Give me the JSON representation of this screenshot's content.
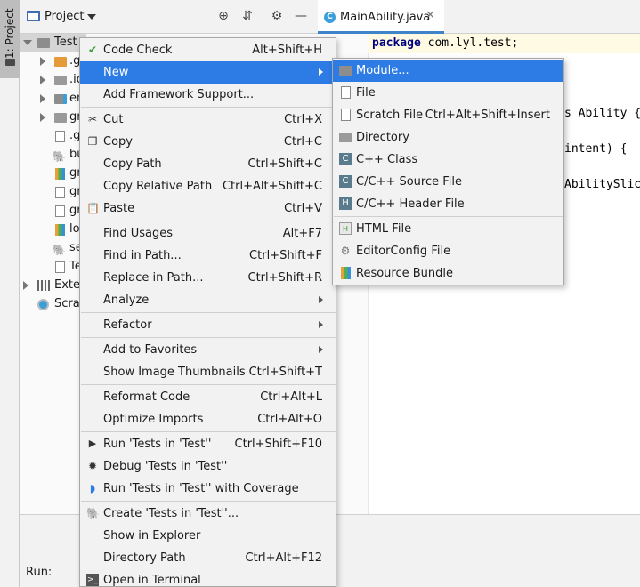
{
  "left_stripe": {
    "project_tab": "1: Project"
  },
  "project_panel": {
    "title": "Project",
    "tree": [
      {
        "label": "Test",
        "icon": "module-folder-icon"
      },
      {
        "label": ".g",
        "icon": "folder-orange-icon"
      },
      {
        "label": ".id",
        "icon": "folder-icon"
      },
      {
        "label": "en",
        "icon": "module-folder-icon"
      },
      {
        "label": "gr",
        "icon": "folder-icon"
      },
      {
        "label": ".g",
        "icon": "file-icon"
      },
      {
        "label": "bu",
        "icon": "gradle-icon"
      },
      {
        "label": "gr",
        "icon": "properties-file-icon"
      },
      {
        "label": "gr",
        "icon": "file-icon"
      },
      {
        "label": "gr",
        "icon": "file-icon"
      },
      {
        "label": "lo",
        "icon": "properties-file-icon"
      },
      {
        "label": "se",
        "icon": "gradle-icon"
      },
      {
        "label": "Te",
        "icon": "file-icon"
      },
      {
        "label": "Exter",
        "icon": "library-icon"
      },
      {
        "label": "Scrat",
        "icon": "scratches-icon"
      }
    ]
  },
  "editor": {
    "tab_label": "MainAbility.java",
    "code": {
      "line1_keyword": "package",
      "line1_rest": " com.lyl.test;",
      "frag1": "s Ability {",
      "frag2": "intent) {",
      "frag3": "AbilitySlice"
    }
  },
  "run_bar": {
    "label": "Run:"
  },
  "context_menu": {
    "items": [
      {
        "label": "Code Check",
        "shortcut": "Alt+Shift+H"
      },
      {
        "label": "New",
        "shortcut": ""
      },
      {
        "label": "Add Framework Support...",
        "shortcut": ""
      },
      {
        "label": "Cut",
        "shortcut": "Ctrl+X"
      },
      {
        "label": "Copy",
        "shortcut": "Ctrl+C"
      },
      {
        "label": "Copy Path",
        "shortcut": "Ctrl+Shift+C"
      },
      {
        "label": "Copy Relative Path",
        "shortcut": "Ctrl+Alt+Shift+C"
      },
      {
        "label": "Paste",
        "shortcut": "Ctrl+V"
      },
      {
        "label": "Find Usages",
        "shortcut": "Alt+F7"
      },
      {
        "label": "Find in Path...",
        "shortcut": "Ctrl+Shift+F"
      },
      {
        "label": "Replace in Path...",
        "shortcut": "Ctrl+Shift+R"
      },
      {
        "label": "Analyze",
        "shortcut": ""
      },
      {
        "label": "Refactor",
        "shortcut": ""
      },
      {
        "label": "Add to Favorites",
        "shortcut": ""
      },
      {
        "label": "Show Image Thumbnails",
        "shortcut": "Ctrl+Shift+T"
      },
      {
        "label": "Reformat Code",
        "shortcut": "Ctrl+Alt+L"
      },
      {
        "label": "Optimize Imports",
        "shortcut": "Ctrl+Alt+O"
      },
      {
        "label": "Run 'Tests in 'Test''",
        "shortcut": "Ctrl+Shift+F10"
      },
      {
        "label": "Debug 'Tests in 'Test''",
        "shortcut": ""
      },
      {
        "label": "Run 'Tests in 'Test'' with Coverage",
        "shortcut": ""
      },
      {
        "label": "Create 'Tests in 'Test''...",
        "shortcut": ""
      },
      {
        "label": "Show in Explorer",
        "shortcut": ""
      },
      {
        "label": "Directory Path",
        "shortcut": "Ctrl+Alt+F12"
      },
      {
        "label": "Open in Terminal",
        "shortcut": ""
      }
    ]
  },
  "new_submenu": {
    "items": [
      {
        "label": "Module...",
        "shortcut": ""
      },
      {
        "label": "File",
        "shortcut": ""
      },
      {
        "label": "Scratch File",
        "shortcut": "Ctrl+Alt+Shift+Insert"
      },
      {
        "label": "Directory",
        "shortcut": ""
      },
      {
        "label": "C++ Class",
        "shortcut": ""
      },
      {
        "label": "C/C++ Source File",
        "shortcut": ""
      },
      {
        "label": "C/C++ Header File",
        "shortcut": ""
      },
      {
        "label": "HTML File",
        "shortcut": ""
      },
      {
        "label": "EditorConfig File",
        "shortcut": ""
      },
      {
        "label": "Resource Bundle",
        "shortcut": ""
      }
    ]
  },
  "colors": {
    "highlight": "#2d7be5",
    "menu_bg": "#f2f2f2",
    "tab_accent": "#4083c9"
  }
}
